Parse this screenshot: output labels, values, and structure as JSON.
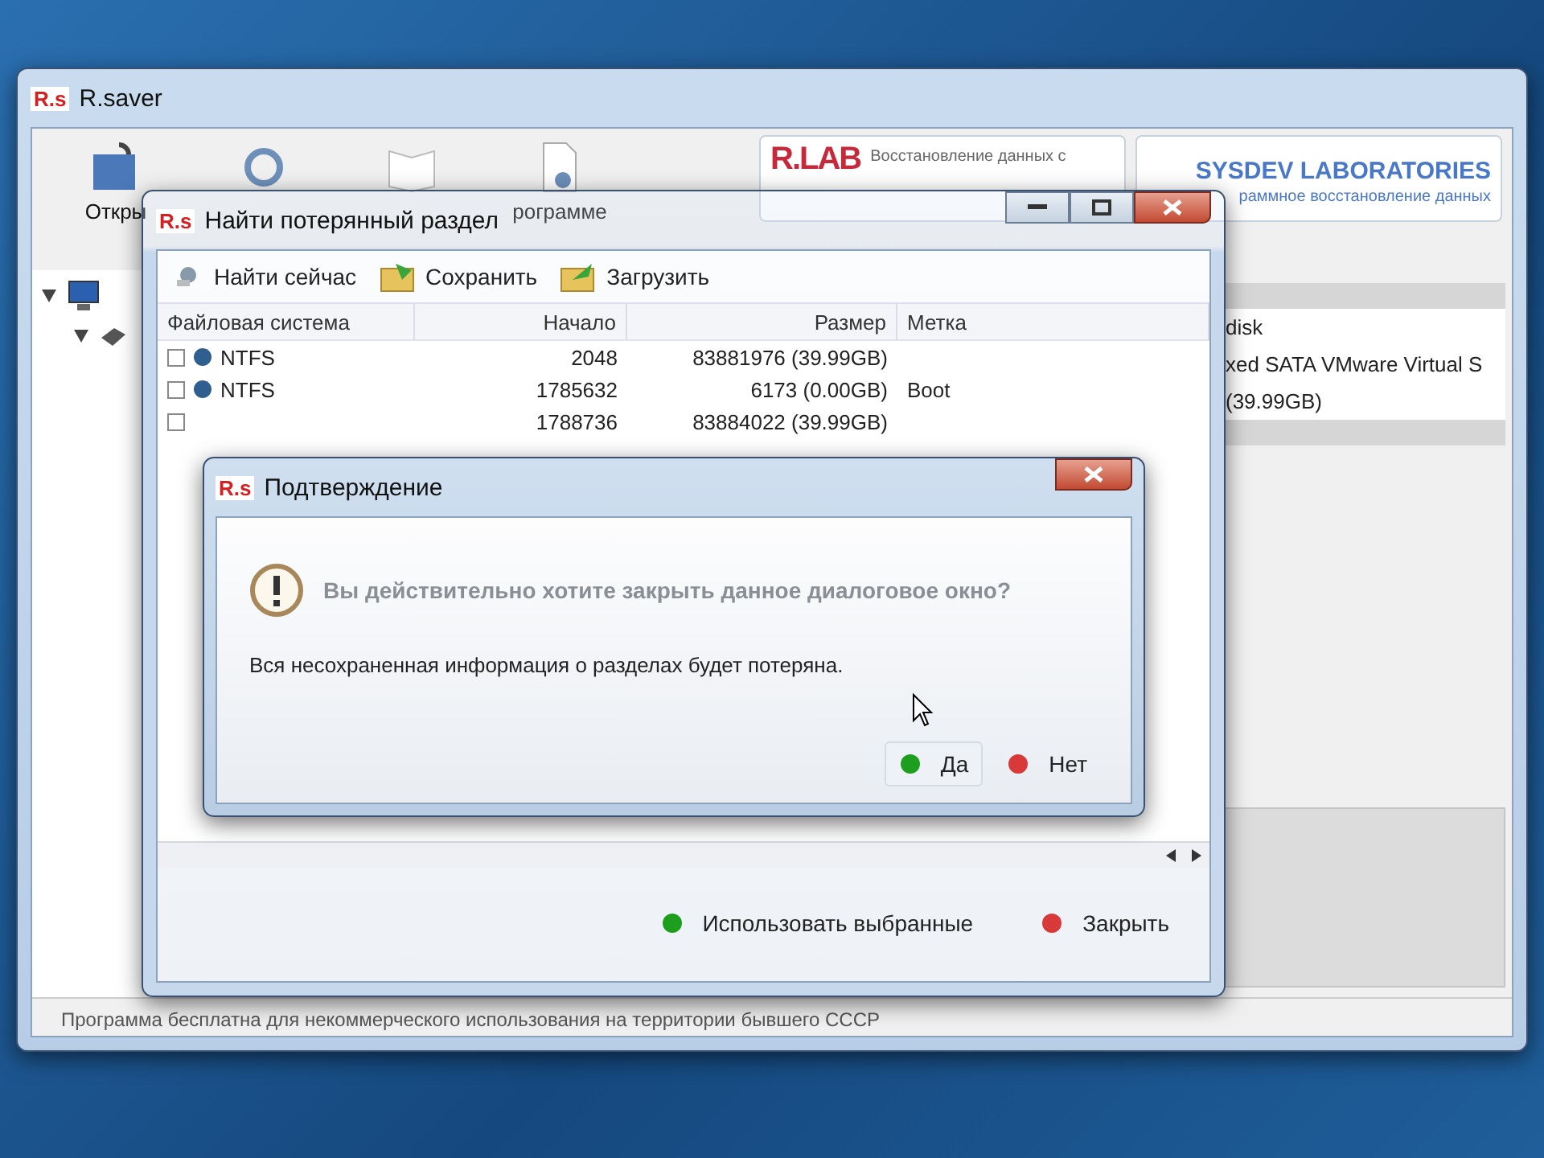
{
  "main_window": {
    "badge": "R.s",
    "title": "R.saver",
    "toolbar": [
      {
        "kind": "open",
        "label": "Откры"
      },
      {
        "kind": "refresh"
      },
      {
        "kind": "book"
      },
      {
        "kind": "about",
        "label": "рограмме"
      }
    ],
    "logos": [
      {
        "kind": "rlab",
        "mark": "R.LAB",
        "caption": "Восстановление данных с"
      },
      {
        "kind": "sysdev",
        "mark": "SYSDEV LABORATORIES",
        "caption": "раммное восстановление данных"
      }
    ],
    "disk_info": [
      "disk",
      "xed SATA VMware Virtual S",
      "(39.99GB)"
    ],
    "status_bar": "Программа бесплатна для некоммерческого использования на территории бывшего СССР"
  },
  "find_window": {
    "badge": "R.s",
    "title": "Найти потерянный раздел",
    "toolbar": [
      {
        "kind": "search",
        "label": "Найти сейчас"
      },
      {
        "kind": "save",
        "label": "Сохранить"
      },
      {
        "kind": "load",
        "label": "Загрузить"
      }
    ],
    "columns": [
      "Файловая система",
      "Начало",
      "Размер",
      "Метка"
    ],
    "rows": [
      {
        "checked": false,
        "filesystem": "NTFS",
        "start": "2048",
        "size": "83881976 (39.99GB)"
      },
      {
        "checked": false,
        "filesystem": "NTFS",
        "start": "1785632",
        "size": "6173 (0.00GB)",
        "label": "Boot"
      },
      {
        "checked": false,
        "start": "1788736",
        "size": "83884022 (39.99GB)"
      }
    ],
    "buttons": [
      {
        "label": "Использовать выбранные",
        "color": "#1e9e1e"
      },
      {
        "label": "Закрыть",
        "color": "#d83a3a"
      }
    ]
  },
  "confirm_dialog": {
    "badge": "R.s",
    "title": "Подтверждение",
    "question": "Вы действительно хотите закрыть данное диалоговое окно?",
    "message": "Вся несохраненная информация о разделах будет потеряна.",
    "buttons": [
      {
        "label": "Да",
        "color": "#1e9e1e",
        "hovered": true
      },
      {
        "label": "Нет",
        "color": "#d83a3a",
        "hovered": false
      }
    ]
  }
}
